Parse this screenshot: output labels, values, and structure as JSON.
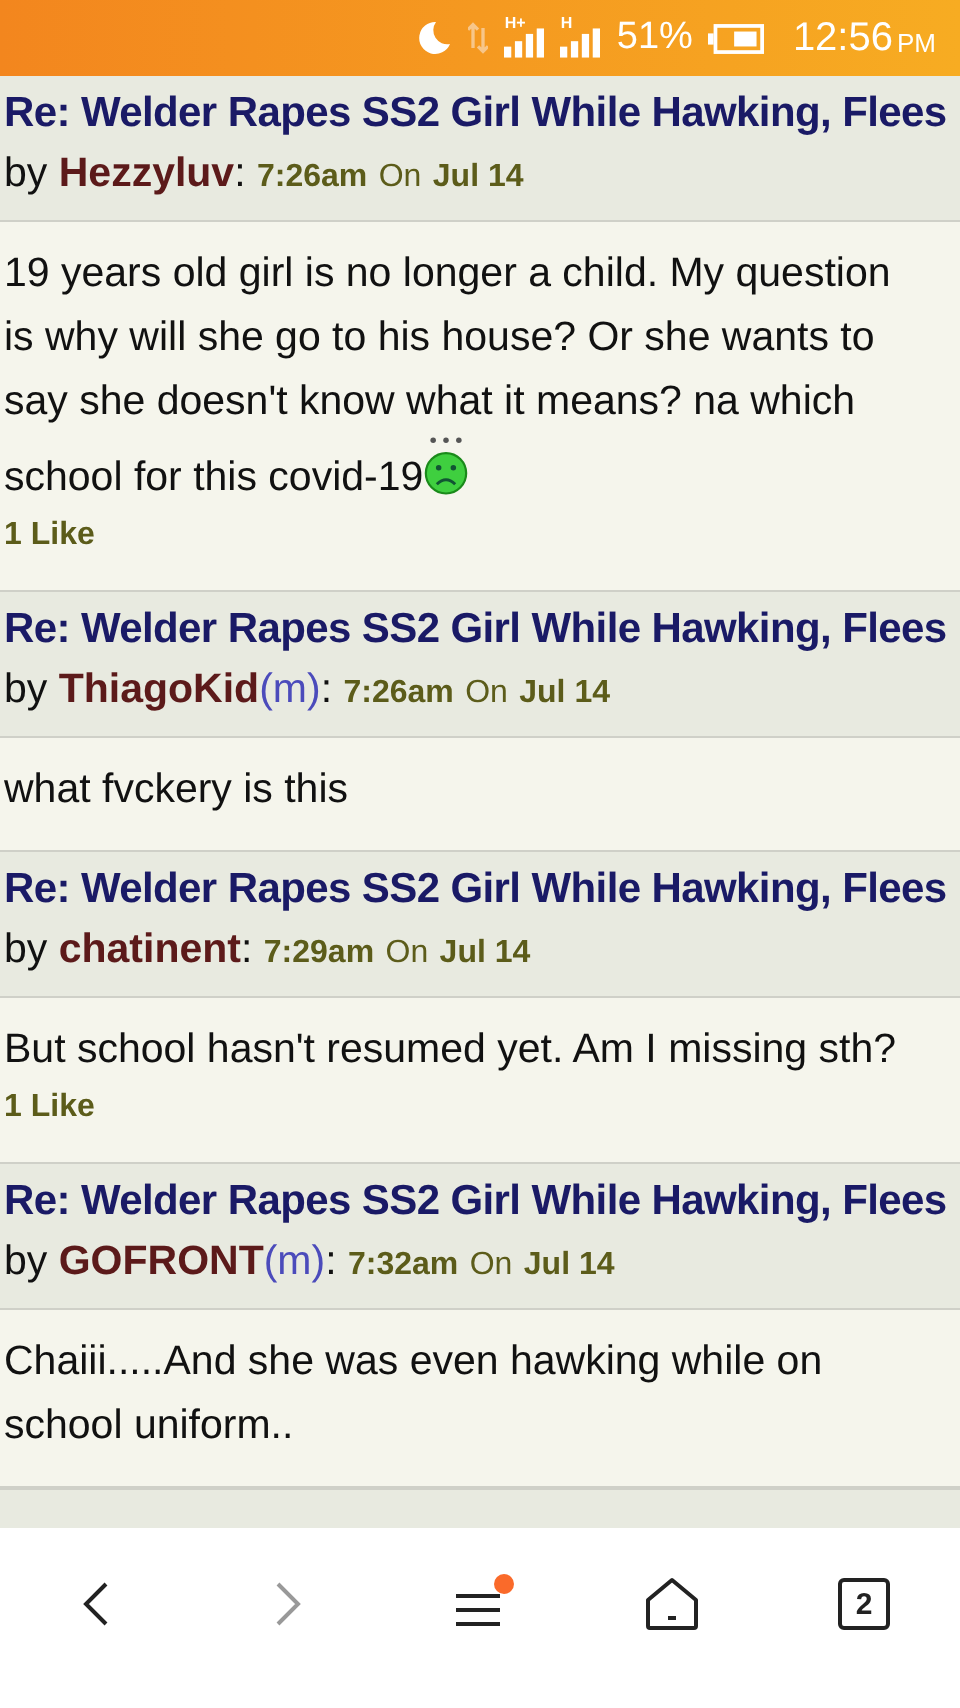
{
  "status_bar": {
    "networks": [
      {
        "label": "H+"
      },
      {
        "label": "H"
      }
    ],
    "battery": "51%",
    "time": "12:56",
    "meridiem": "PM"
  },
  "posts": [
    {
      "title": "Re: Welder Rapes SS2 Girl While Hawking, Flees",
      "by": "by",
      "author": "Hezzyluv",
      "colon": ":",
      "time": "7:26am",
      "on": "On",
      "date": "Jul 14",
      "lines": [
        "19 years old girl is no longer a child. My question",
        "is why will she go to his house? Or she wants to",
        "say she doesn't know what it means? na which",
        "school for this covid-19"
      ],
      "emoticon": true,
      "likes": "1 Like"
    },
    {
      "title": "Re: Welder Rapes SS2 Girl While Hawking, Flees",
      "by": "by",
      "author": "ThiagoKid",
      "moderator": "(m)",
      "colon": ":",
      "time": "7:26am",
      "on": "On",
      "date": "Jul 14",
      "lines": [
        "what fvckery is this"
      ]
    },
    {
      "title": "Re: Welder Rapes SS2 Girl While Hawking, Flees",
      "by": "by",
      "author": "chatinent",
      "colon": ":",
      "time": "7:29am",
      "on": "On",
      "date": "Jul 14",
      "lines": [
        "But school hasn't resumed yet. Am I missing sth?"
      ],
      "likes": "1 Like"
    },
    {
      "title": "Re: Welder Rapes SS2 Girl While Hawking, Flees",
      "by": "by",
      "author": "GOFRONT",
      "moderator": "(m)",
      "colon": ":",
      "time": "7:32am",
      "on": "On",
      "date": "Jul 14",
      "lines": [
        "Chaiii.....And she was even hawking while on",
        "school uniform.."
      ]
    }
  ],
  "nav": [
    {
      "kind": "back",
      "disabled": false
    },
    {
      "kind": "forward",
      "disabled": true
    },
    {
      "kind": "menu",
      "badge": true
    },
    {
      "kind": "home"
    },
    {
      "kind": "tabs",
      "count": "2"
    }
  ]
}
